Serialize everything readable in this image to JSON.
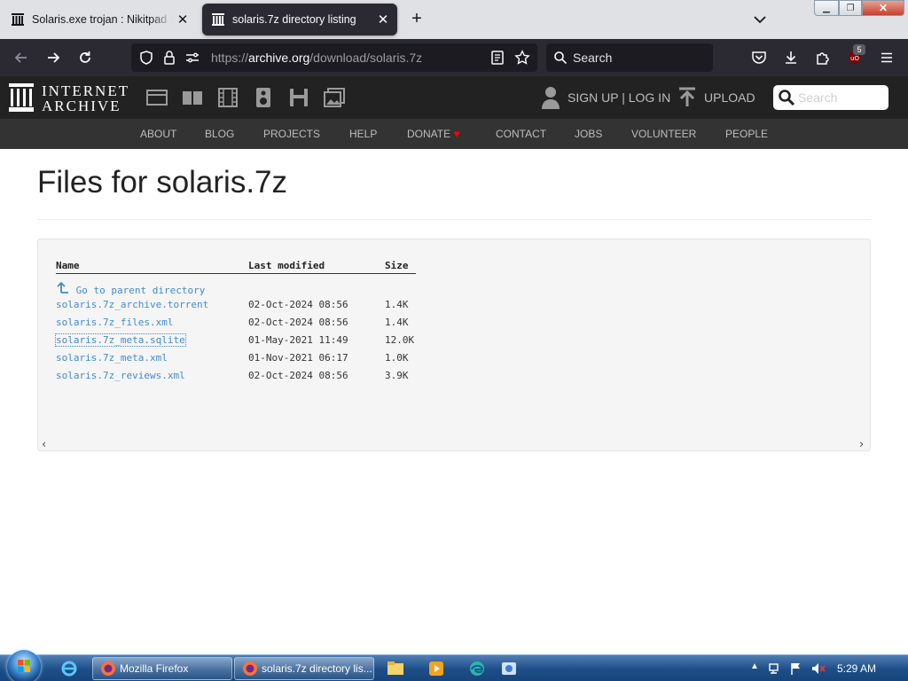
{
  "browser": {
    "tabs": [
      {
        "title": "Solaris.exe trojan : Nikitpad : Fre",
        "active": false
      },
      {
        "title": "solaris.7z directory listing",
        "active": true
      }
    ],
    "url": {
      "scheme": "https://",
      "host": "archive.org",
      "path": "/download/solaris.7z"
    },
    "search_placeholder": "Search",
    "extension_badge": "5"
  },
  "ia": {
    "logo_line1": "INTERNET",
    "logo_line2": "ARCHIVE",
    "signup_login": "SIGN UP | LOG IN",
    "upload": "UPLOAD",
    "search_placeholder": "Search",
    "nav": [
      "ABOUT",
      "BLOG",
      "PROJECTS",
      "HELP",
      "DONATE",
      "CONTACT",
      "JOBS",
      "VOLUNTEER",
      "PEOPLE"
    ],
    "donate_heart_color": "#ff0100"
  },
  "page": {
    "title": "Files for solaris.7z",
    "listing": {
      "headers": {
        "name": "Name",
        "modified": "Last modified",
        "size": "Size"
      },
      "parent": "Go to parent directory",
      "files": [
        {
          "name": "solaris.7z_archive.torrent",
          "modified": "02-Oct-2024 08:56",
          "size": "1.4K"
        },
        {
          "name": "solaris.7z_files.xml",
          "modified": "02-Oct-2024 08:56",
          "size": "1.4K"
        },
        {
          "name": "solaris.7z_meta.sqlite",
          "modified": "01-May-2021 11:49",
          "size": "12.0K"
        },
        {
          "name": "solaris.7z_meta.xml",
          "modified": "01-Nov-2021 06:17",
          "size": "1.0K"
        },
        {
          "name": "solaris.7z_reviews.xml",
          "modified": "02-Oct-2024 08:56",
          "size": "3.9K"
        }
      ]
    }
  },
  "taskbar": {
    "buttons": [
      "Mozilla Firefox",
      "solaris.7z directory lis..."
    ],
    "time": "5:29 AM"
  },
  "colors": {
    "link": "#428bca",
    "ia_dark": "#222222",
    "ia_nav": "#333333",
    "firefox_toolbar": "#2b2a33"
  }
}
